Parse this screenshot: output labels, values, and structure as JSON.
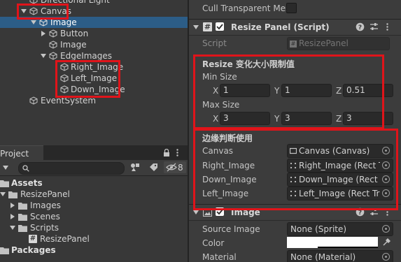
{
  "hierarchy": {
    "items": [
      {
        "label": "Directional Light"
      },
      {
        "label": "Canvas"
      },
      {
        "label": "Image"
      },
      {
        "label": "Button"
      },
      {
        "label": "Image"
      },
      {
        "label": "EdgeImages"
      },
      {
        "label": "Right_Image"
      },
      {
        "label": "Left_Image"
      },
      {
        "label": "Down_Image"
      },
      {
        "label": "EventSystem"
      }
    ]
  },
  "project": {
    "tab_label": "Project",
    "hidden_count": "8",
    "tree": [
      {
        "label": "Assets"
      },
      {
        "label": "ResizePanel"
      },
      {
        "label": "Images"
      },
      {
        "label": "Scenes"
      },
      {
        "label": "Scripts"
      },
      {
        "label": "ResizePanel"
      },
      {
        "label": "Packages"
      }
    ]
  },
  "inspector": {
    "cull_label": "Cull Transparent Mes",
    "resize_component": {
      "title": "Resize Panel (Script)",
      "script_label": "Script",
      "script_value": "ResizePanel"
    },
    "size_section": {
      "header": "Resize 变化大小限制值",
      "min_label": "Min Size",
      "min": {
        "x_label": "X",
        "x": "1",
        "y_label": "Y",
        "y": "1",
        "z_label": "Z",
        "z": "0.51"
      },
      "max_label": "Max Size",
      "max": {
        "x_label": "X",
        "x": "3",
        "y_label": "Y",
        "y": "3",
        "z_label": "Z",
        "z": "3"
      }
    },
    "edge_section": {
      "header": "边缘判断使用",
      "fields": [
        {
          "label": "Canvas",
          "value": "Canvas (Canvas)"
        },
        {
          "label": "Right_Image",
          "value": "Right_Image (Rect Tra"
        },
        {
          "label": "Down_Image",
          "value": "Down_Image (Rect Tr"
        },
        {
          "label": "Left_Image",
          "value": "Left_Image (Rect Tran"
        }
      ]
    },
    "image_component": {
      "title": "Image",
      "source_label": "Source Image",
      "source_value": "None (Sprite)",
      "color_label": "Color",
      "color_value": "#ffffff",
      "material_label": "Material",
      "material_value": "None (Material)"
    }
  },
  "colors": {
    "selection": "#2c5d87",
    "highlight_box": "#e0141a",
    "panel_bg": "#383838",
    "inspector_bg": "#3c3c3c"
  }
}
